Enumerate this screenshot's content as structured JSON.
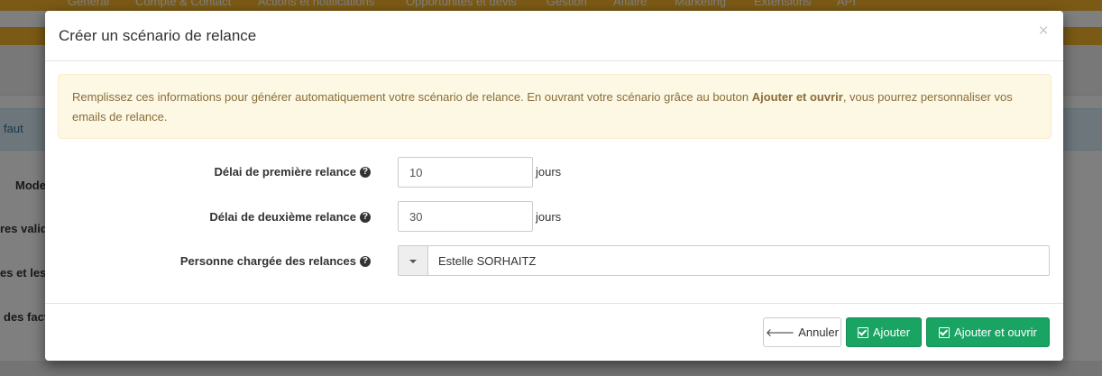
{
  "background": {
    "menu": [
      "Général",
      "Compte & Contact",
      "Actions et notifications",
      "Opportunités et devis",
      "Gestion",
      "Affaire",
      "Marketing",
      "Extensions",
      "API"
    ],
    "info_bar_text": "faut",
    "side_labels": [
      "Mode",
      "res valid",
      "es et les",
      "des fact"
    ]
  },
  "modal": {
    "title": "Créer un scénario de relance",
    "close_symbol": "×",
    "alert": {
      "text_before": "Remplissez ces informations pour générer automatiquement votre scénario de relance. En ouvrant votre scénario grâce au bouton ",
      "bold_text": "Ajouter et ouvrir",
      "text_after": ", vous pourrez personnaliser vos emails de relance."
    },
    "form": {
      "first_delay_label": "Délai de première relance",
      "first_delay_value": "10",
      "first_delay_unit": "jours",
      "second_delay_label": "Délai de deuxième relance",
      "second_delay_value": "30",
      "second_delay_unit": "jours",
      "person_label": "Personne chargée des relances",
      "person_value": "Estelle SORHAITZ",
      "help_symbol": "?"
    },
    "footer": {
      "cancel_label": "Annuler",
      "add_label": "Ajouter",
      "add_open_label": "Ajouter et ouvrir"
    }
  }
}
